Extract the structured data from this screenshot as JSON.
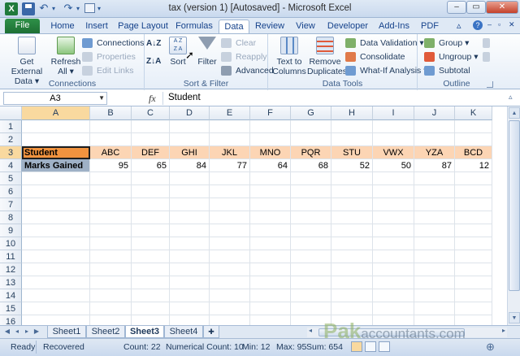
{
  "window": {
    "title": "tax (version 1) [Autosaved] - Microsoft Excel",
    "minimize": "–",
    "restore": "▭",
    "close": "✕"
  },
  "qat": {
    "undo": "↶",
    "redo": "↷",
    "dropdown": "▾"
  },
  "tabs": [
    "File",
    "Home",
    "Insert",
    "Page Layout",
    "Formulas",
    "Data",
    "Review",
    "View",
    "Developer",
    "Add-Ins",
    "PDF"
  ],
  "active_tab": "Data",
  "ribbon": {
    "groups": {
      "connections": "Connections",
      "sort_filter": "Sort & Filter",
      "data_tools": "Data Tools",
      "outline": "Outline"
    },
    "get_external_data": "Get External Data ▾",
    "refresh_all": "Refresh All ▾",
    "connections_btn": "Connections",
    "properties_btn": "Properties",
    "edit_links_btn": "Edit Links",
    "sort_az": "A↓Z",
    "sort_za": "Z↓A",
    "sort_btn": "Sort",
    "filter_btn": "Filter",
    "clear_btn": "Clear",
    "reapply_btn": "Reapply",
    "advanced_btn": "Advanced",
    "text_to_columns": "Text to Columns",
    "remove_duplicates": "Remove Duplicates",
    "data_validation": "Data Validation ▾",
    "consolidate": "Consolidate",
    "what_if": "What-If Analysis ▾",
    "group_btn": "Group ▾",
    "ungroup_btn": "Ungroup ▾",
    "subtotal_btn": "Subtotal"
  },
  "formula_bar": {
    "name_box": "A3",
    "fx": "fx",
    "content": "Student"
  },
  "sheet": {
    "columns": [
      "A",
      "B",
      "C",
      "D",
      "E",
      "F",
      "G",
      "H",
      "I",
      "J",
      "K"
    ],
    "rows": [
      "1",
      "2",
      "3",
      "4",
      "5",
      "6",
      "7",
      "8",
      "9",
      "10",
      "11",
      "12",
      "13",
      "14",
      "15",
      "16"
    ],
    "row3": [
      "Student",
      "ABC",
      "DEF",
      "GHI",
      "JKL",
      "MNO",
      "PQR",
      "STU",
      "VWX",
      "YZA",
      "BCD"
    ],
    "row4": [
      "Marks Gained",
      "95",
      "65",
      "84",
      "77",
      "64",
      "68",
      "52",
      "50",
      "87",
      "12"
    ],
    "selected_cell": "A3"
  },
  "sheet_tabs": [
    "Sheet1",
    "Sheet2",
    "Sheet3",
    "Sheet4"
  ],
  "active_sheet": "Sheet3",
  "status_bar": {
    "ready": "Ready",
    "recovered": "Recovered",
    "count": "Count: 22",
    "numerical_count": "Numerical Count: 10",
    "min": "Min: 12",
    "max": "Max: 95",
    "sum": "Sum: 654"
  },
  "watermark": {
    "brand": "Pak",
    "suffix": "accountants.com"
  },
  "colors": {
    "header_orange": "#f1933f",
    "header_peach": "#fcd5b4",
    "row_label_gray": "#9fb1c6",
    "file_tab_green": "#1e6f34"
  }
}
